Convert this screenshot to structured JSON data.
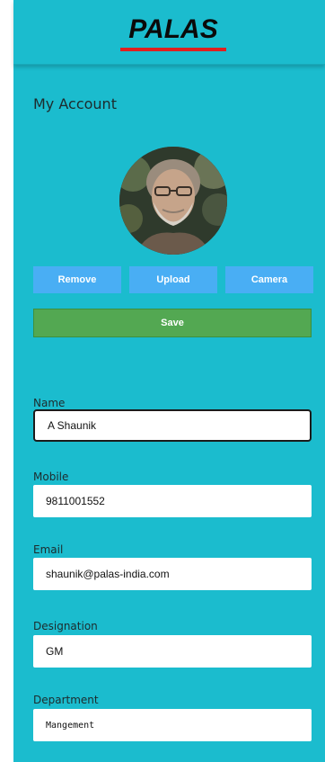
{
  "header": {
    "logo_text": "PALAS",
    "logo_underline_color": "#e02020"
  },
  "page": {
    "title": "My Account"
  },
  "avatar": {
    "alt": "profile photo"
  },
  "photo_actions": {
    "remove_label": "Remove",
    "upload_label": "Upload",
    "camera_label": "Camera"
  },
  "save_label": "Save",
  "fields": [
    {
      "label": "Name",
      "value": "A Shaunik"
    },
    {
      "label": "Mobile",
      "value": "9811001552"
    },
    {
      "label": "Email",
      "value": "shaunik@palas-india.com"
    },
    {
      "label": "Designation",
      "value": "GM"
    },
    {
      "label": "Department",
      "value": "Mangement"
    }
  ],
  "colors": {
    "background": "#1bbcce",
    "action_button": "#49aef4",
    "save_button": "#53a852"
  }
}
